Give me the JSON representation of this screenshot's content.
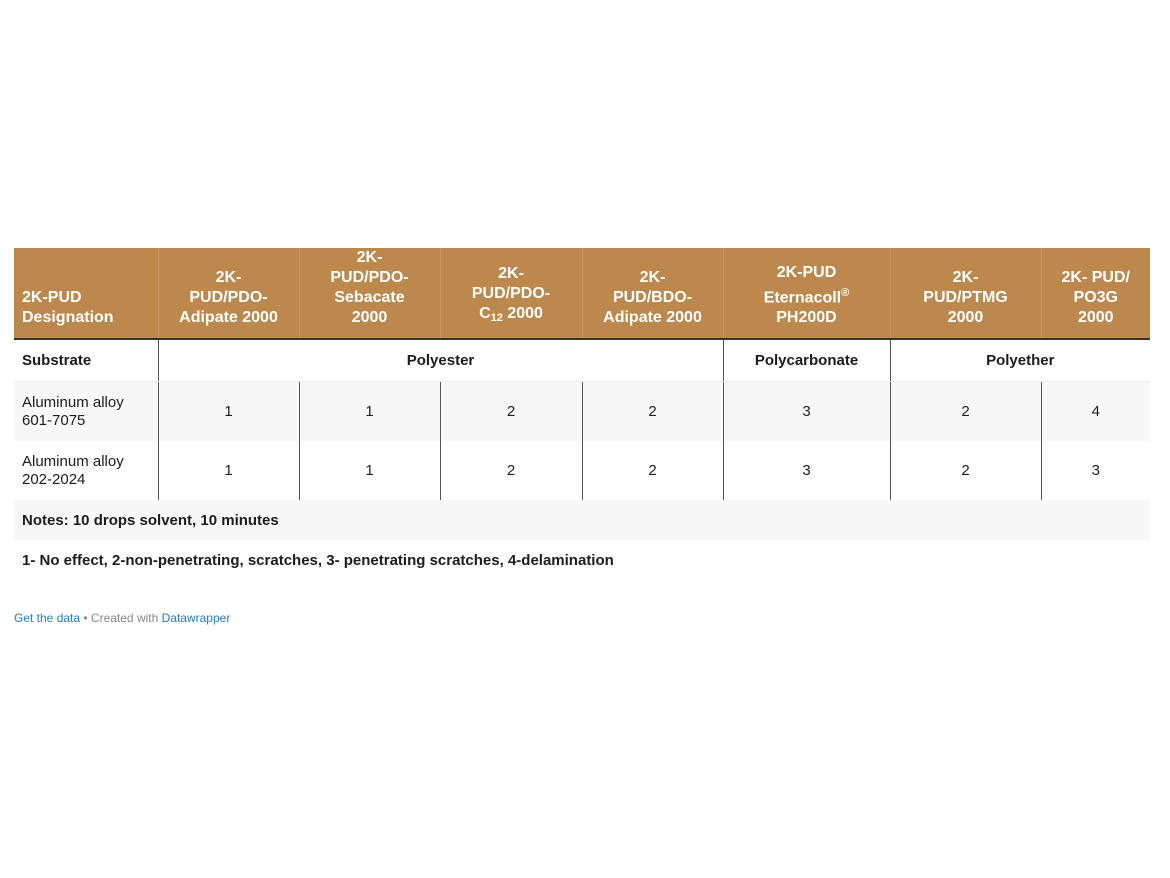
{
  "header": {
    "designation": "2K-PUD Designation",
    "columns": [
      {
        "line1": "2K-",
        "line2": "PUD/PDO-",
        "line3": "Adipate 2000"
      },
      {
        "line1": "2K-",
        "line2": "PUD/PDO-",
        "line3": "Sebacate",
        "line4": "2000"
      },
      {
        "line1": "2K-",
        "line2": "PUD/PDO-",
        "c": "C",
        "sub": "12",
        "line3": " 2000"
      },
      {
        "line1": "2K-",
        "line2": "PUD/BDO-",
        "line3": "Adipate 2000"
      },
      {
        "line1": "2K-PUD",
        "line2": "Eternacoll",
        "sup": "®",
        "line3": "PH200D"
      },
      {
        "line1": "2K-",
        "line2": "PUD/PTMG",
        "line3": "2000"
      },
      {
        "line1": "2K- PUD/",
        "line2": "PO3G",
        "line3": "2000"
      }
    ]
  },
  "groups": {
    "substrate": "Substrate",
    "polyester": "Polyester",
    "polycarbonate": "Polycarbonate",
    "polyether": "Polyether"
  },
  "rows": [
    {
      "name": "Aluminum alloy",
      "code": "601-7075",
      "values": [
        "1",
        "1",
        "2",
        "2",
        "3",
        "2",
        "4"
      ]
    },
    {
      "name": "Aluminum alloy",
      "code": "202-2024",
      "values": [
        "1",
        "1",
        "2",
        "2",
        "3",
        "2",
        "3"
      ]
    }
  ],
  "notes": "Notes: 10 drops solvent, 10 minutes",
  "legend": "1- No effect, 2-non-penetrating, scratches, 3- penetrating scratches, 4-delamination",
  "footer": {
    "get_data": "Get the data",
    "sep": " • Created with ",
    "datawrapper": "Datawrapper"
  }
}
